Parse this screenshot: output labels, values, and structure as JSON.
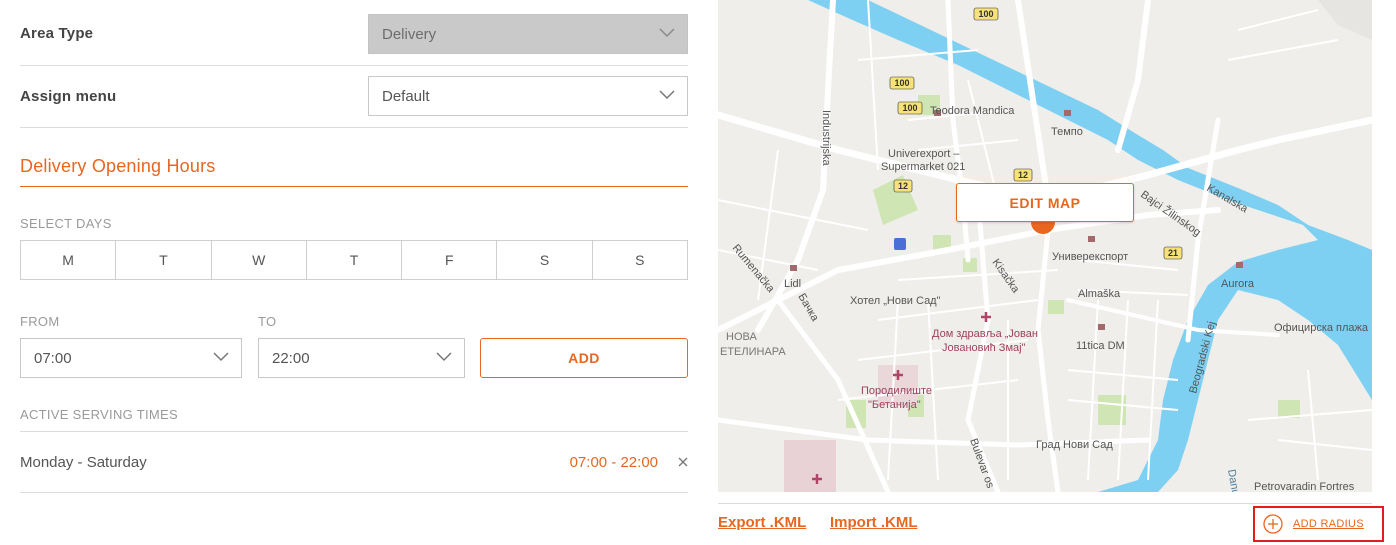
{
  "area_type": {
    "label": "Area Type",
    "value": "Delivery"
  },
  "assign_menu": {
    "label": "Assign menu",
    "value": "Default"
  },
  "section_title": "Delivery Opening Hours",
  "select_days_label": "SELECT DAYS",
  "days": [
    "M",
    "T",
    "W",
    "T",
    "F",
    "S",
    "S"
  ],
  "from": {
    "label": "FROM",
    "value": "07:00"
  },
  "to": {
    "label": "TO",
    "value": "22:00"
  },
  "add_label": "ADD",
  "active_serving_label": "ACTIVE SERVING TIMES",
  "serving": {
    "days": "Monday - Saturday",
    "time": "07:00 - 22:00"
  },
  "map": {
    "edit_label": "EDIT MAP",
    "labels": [
      "Teodora Mandica",
      "Темпо",
      "Univerexport –",
      "Supermarket 021",
      "Industrijska",
      "Kanalska",
      "Bajci Žilinskog",
      "Универекспорт",
      "Rumenačka",
      "Lidl",
      "Хотел „Нови Сад\"",
      "Kisačka",
      "Almaška",
      "Aurora",
      "Бачка",
      "НОВА",
      "ЕТЕЛИНАРА",
      "Дом здравља „Јован",
      "Јовановић Змај\"",
      "11tica DM",
      "Официрска плажа",
      "Beogradski Kej",
      "Породилиште",
      "\"Бетанија\"",
      "Bulevar os",
      "Град Нови Сад",
      "Danub",
      "Petrovaradin Fortres"
    ],
    "road_badges": [
      "100",
      "100",
      "100",
      "12",
      "12",
      "21"
    ],
    "colors": {
      "water": "#7ed0f2",
      "road": "#ffffff",
      "land": "#efeeea",
      "park": "#cfe6b4",
      "badge": "#f7e27a",
      "accent": "#e8661f"
    }
  },
  "export_label": "Export .KML",
  "import_label": "Import .KML",
  "add_radius_label": "ADD RADIUS",
  "icons": [
    "chevron-down-icon",
    "close-icon",
    "plus-circle-icon",
    "map-pin-icon"
  ]
}
